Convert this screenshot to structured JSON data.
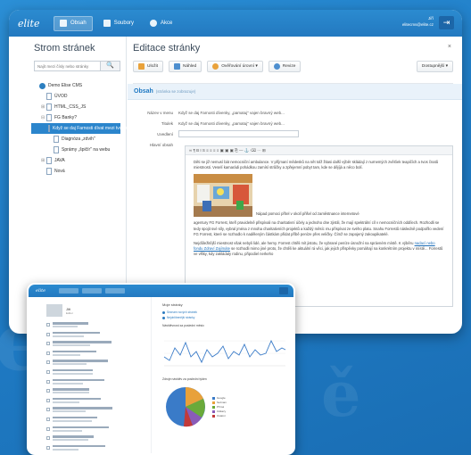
{
  "app": {
    "logo": "elite",
    "nav": [
      {
        "label": "Obsah",
        "active": true
      },
      {
        "label": "Soubory",
        "active": false
      },
      {
        "label": "Akce",
        "active": false
      }
    ],
    "user_line1": "Jiří",
    "user_line2": "elitecms@elite.cz",
    "accent": "#2b85cc"
  },
  "tree": {
    "title": "Strom stránek",
    "search_placeholder": "Najít mezi čísly nebo stránky",
    "search_button": "🔍",
    "items": [
      {
        "label": "Demo Elise CMS",
        "level": 0,
        "type": "globe",
        "expander": ""
      },
      {
        "label": "ÚVOD",
        "level": 1,
        "type": "page",
        "expander": ""
      },
      {
        "label": "HTML_CSS_JS",
        "level": 1,
        "type": "page",
        "expander": "⊞"
      },
      {
        "label": "FG Banky?",
        "level": 1,
        "type": "page",
        "expander": "⊟"
      },
      {
        "label": "Když se daj Farnosti dívat mezi tvořenky",
        "level": 2,
        "type": "page",
        "expander": "",
        "selected": true
      },
      {
        "label": "Diagnóza „zdvih\"",
        "level": 2,
        "type": "page",
        "expander": ""
      },
      {
        "label": "Sprámy „špičír\" na webu",
        "level": 2,
        "type": "page",
        "expander": ""
      },
      {
        "label": "JAVA",
        "level": 1,
        "type": "page",
        "expander": "⊞"
      },
      {
        "label": "Nová",
        "level": 1,
        "type": "page",
        "expander": ""
      }
    ]
  },
  "editor": {
    "title": "Editace stránky",
    "close": "×",
    "toolbar": [
      {
        "label": "Uložit",
        "color": "#e9a23b"
      },
      {
        "label": "Náhled",
        "color": "#4e8fcf"
      },
      {
        "label": "Ověřování úrovní ▾",
        "color": "#e9a23b"
      },
      {
        "label": "Revize",
        "color": "#4e8fcf"
      }
    ],
    "more_menu": "Dostupnější ▾",
    "section_title": "Obsah",
    "section_sub": "(stránka se zobrazuje)",
    "fields": [
      {
        "label": "Název v menu",
        "value": "Když se daj Farnosti dívenky, „pamatuj\" vajen bravný web..."
      },
      {
        "label": "Titulek",
        "value": "Když se daj Farnosti dívenky, „pamatuj\" vajen bravný web..."
      },
      {
        "label": "Uvedlení",
        "value": ""
      }
    ],
    "content_label": "Hlavní obsah",
    "editor_tools": "∞  ¶  B  I  S  ≡  ≡  ≡  ≡  ▣  ▣  ▣  ⎘  —  ⚓  ⌫  ···  ⊞",
    "paragraphs": [
      "Děti se již nemusí bát nemocniční ambulance. V příjmaní mědesků na nět tolž žitasi další výběr skládají z nurnemých zvěiťiek teapičích a tvos čnatů miestnosti. Veselí kamarádi pohádkou zamísí strůčky a zpřejemní pobyt tam, kde se dějíjá a něco bolí.",
      "Nápad pomoci přítel v okolí přišel od zaměstnance internetové",
      "agentury FG Forrest, kteří pravidelně přispívali na charitativní účely a jednoho dne zjistili, že mají spektrální cíl v nemocničních oddílech. Rozhodli se tedy spojit své síly, vybral jména z mnoha charitativních projektů a každý měsíc mu přispívat ze svého platu. Snahu Forrestů následně podpořilo vedení FG Forrest, které se rozhodlo k naděleným částkám přidat příbě peníze přes veličky. Čímž se zapojený zakoupikatelé.",
      "Nejdůležitější miestnost však nebyli lidé, ale herny. Forrest chtěli mít jistotu, že vybrané peníze úsnožní na správném místě. K výběru",
      "nadací nebo fondu Zdraví Zajímáte",
      "se rozhodli mimo jiné proto, že chtěli ke aktuální rá věci, jak jejich příspěvky pomáhají na konkrétním projektu v místě...",
      "Forrestů ve vlšky, kdy zakládaly rodinu, připodiel nerkeho"
    ]
  },
  "dashboard": {
    "logo": "elite",
    "user_title": "Jiří",
    "user_sub": "Editor",
    "right_title": "Moje stránky",
    "links": [
      "Seznam nových stránek",
      "Nejoblíbenější stránky"
    ],
    "chart1_title": "Návštěvnost za poslední měsíc",
    "chart2_title": "Zdroje návštěv za poslední týden",
    "legend": [
      {
        "label": "Google",
        "color": "#3a7bc8"
      },
      {
        "label": "Seznam",
        "color": "#e8a13a"
      },
      {
        "label": "Přímá",
        "color": "#6aaa3a"
      },
      {
        "label": "Odkazy",
        "color": "#8a5bb8"
      },
      {
        "label": "Ostatní",
        "color": "#c23a3a"
      }
    ],
    "list_count": 14
  }
}
